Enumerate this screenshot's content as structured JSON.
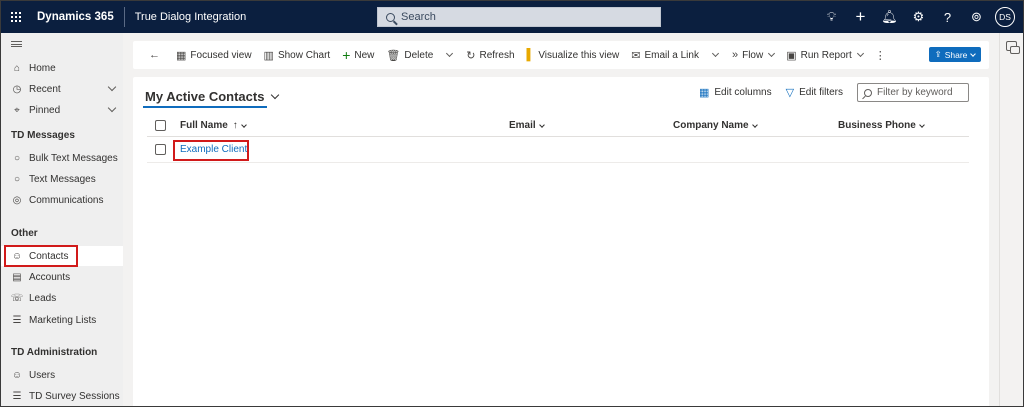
{
  "topbar": {
    "brand": "Dynamics 365",
    "app_name": "True Dialog Integration",
    "search_placeholder": "Search",
    "avatar_initials": "DS",
    "icons": [
      "lightbulb-icon",
      "plus-icon",
      "bell-icon",
      "gear-icon",
      "help-icon",
      "copilot-icon"
    ]
  },
  "sidebar": {
    "items_top": [
      {
        "label": "Home",
        "icon": "home-icon"
      },
      {
        "label": "Recent",
        "icon": "clock-icon"
      },
      {
        "label": "Pinned",
        "icon": "pin-icon"
      }
    ],
    "sections": [
      {
        "title": "TD Messages",
        "items": [
          {
            "label": "Bulk Text Messages",
            "icon": "chat-icon"
          },
          {
            "label": "Text Messages",
            "icon": "chat-icon"
          },
          {
            "label": "Communications",
            "icon": "chat-stack-icon"
          }
        ]
      },
      {
        "title": "Other",
        "items": [
          {
            "label": "Contacts",
            "icon": "person-icon"
          },
          {
            "label": "Accounts",
            "icon": "building-icon"
          },
          {
            "label": "Leads",
            "icon": "phone-person-icon"
          },
          {
            "label": "Marketing Lists",
            "icon": "list-icon"
          }
        ]
      },
      {
        "title": "TD Administration",
        "items": [
          {
            "label": "Users",
            "icon": "person-icon"
          },
          {
            "label": "TD Survey Sessions",
            "icon": "list-icon"
          }
        ]
      }
    ]
  },
  "commands": {
    "focused_view": "Focused view",
    "show_chart": "Show Chart",
    "new": "New",
    "delete": "Delete",
    "refresh": "Refresh",
    "visualize": "Visualize this view",
    "email_link": "Email a Link",
    "flow": "Flow",
    "run_report": "Run Report",
    "share": "Share"
  },
  "view": {
    "title": "My Active Contacts",
    "edit_columns": "Edit columns",
    "edit_filters": "Edit filters",
    "filter_placeholder": "Filter by keyword"
  },
  "grid": {
    "columns": [
      "Full Name",
      "Email",
      "Company Name",
      "Business Phone"
    ],
    "sort_indicator": "↑",
    "rows": [
      {
        "full_name": "Example Client",
        "email": "",
        "company": "",
        "phone": ""
      }
    ]
  }
}
